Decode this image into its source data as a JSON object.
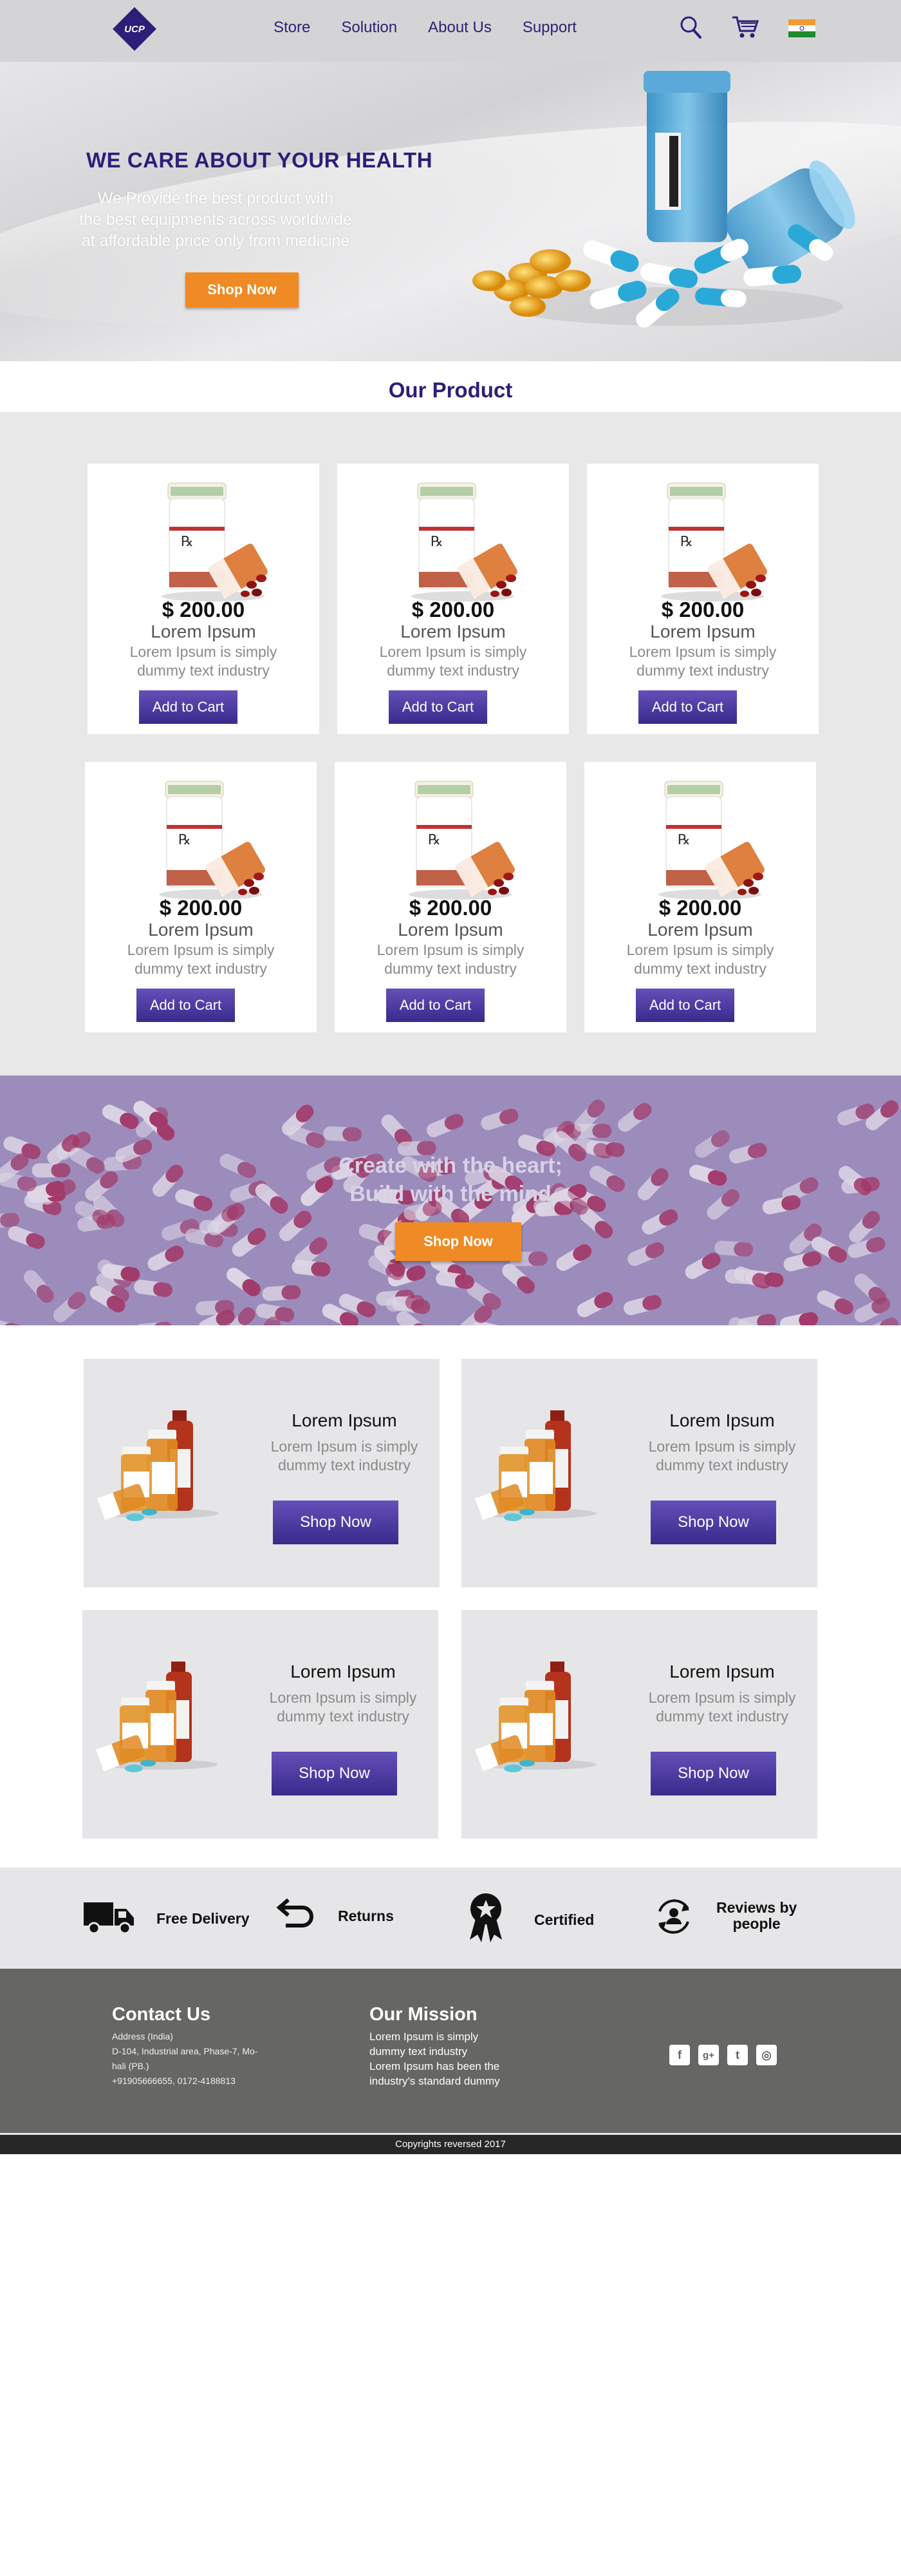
{
  "header": {
    "logo_text": "UCP",
    "nav": [
      "Store",
      "Solution",
      "About Us",
      "Support"
    ],
    "icons": [
      "search-icon",
      "cart-icon",
      "india-flag-icon"
    ]
  },
  "hero": {
    "title": "WE CARE ABOUT YOUR HEALTH",
    "subtitle_lines": [
      "We Provide the best product with",
      "the best equipments across worldwide",
      "at affordable price only from medicine"
    ],
    "button": "Shop Now"
  },
  "products_section": {
    "title": "Our Product",
    "products": [
      {
        "price": "$ 200.00",
        "name": "Lorem Ipsum",
        "desc_lines": [
          "Lorem Ipsum is simply",
          "dummy text  industry"
        ],
        "button": "Add to Cart"
      },
      {
        "price": "$ 200.00",
        "name": "Lorem Ipsum",
        "desc_lines": [
          "Lorem Ipsum is simply",
          "dummy text  industry"
        ],
        "button": "Add to Cart"
      },
      {
        "price": "$ 200.00",
        "name": "Lorem Ipsum",
        "desc_lines": [
          "Lorem Ipsum is simply",
          "dummy text  industry"
        ],
        "button": "Add to Cart"
      },
      {
        "price": "$ 200.00",
        "name": "Lorem Ipsum",
        "desc_lines": [
          "Lorem Ipsum is simply",
          "dummy text  industry"
        ],
        "button": "Add to Cart"
      },
      {
        "price": "$ 200.00",
        "name": "Lorem Ipsum",
        "desc_lines": [
          "Lorem Ipsum is simply",
          "dummy text  industry"
        ],
        "button": "Add to Cart"
      },
      {
        "price": "$ 200.00",
        "name": "Lorem Ipsum",
        "desc_lines": [
          "Lorem Ipsum is simply",
          "dummy text  industry"
        ],
        "button": "Add to Cart"
      }
    ]
  },
  "banner": {
    "lines": [
      "Create with the heart;",
      "Build with the mind"
    ],
    "button": "Shop Now"
  },
  "promos": [
    {
      "title": "Lorem Ipsum",
      "desc_lines": [
        "Lorem Ipsum is simply",
        "dummy text  industry"
      ],
      "button": "Shop Now"
    },
    {
      "title": "Lorem Ipsum",
      "desc_lines": [
        "Lorem Ipsum is simply",
        "dummy text  industry"
      ],
      "button": "Shop Now"
    },
    {
      "title": "Lorem Ipsum",
      "desc_lines": [
        "Lorem Ipsum is simply",
        "dummy text  industry"
      ],
      "button": "Shop Now"
    },
    {
      "title": "Lorem Ipsum",
      "desc_lines": [
        "Lorem Ipsum is simply",
        "dummy text  industry"
      ],
      "button": "Shop Now"
    }
  ],
  "features": [
    {
      "label": "Free Delivery",
      "icon": "truck-icon"
    },
    {
      "label": "Returns",
      "icon": "return-arrow-icon"
    },
    {
      "label": "Certified",
      "icon": "award-ribbon-icon"
    },
    {
      "label_lines": [
        "Reviews by",
        "people"
      ],
      "icon": "user-refresh-icon"
    }
  ],
  "footer": {
    "contact": {
      "title": "Contact Us",
      "lines": [
        "Address (India)",
        "D-104, Industrial area, Phase-7, Mo-",
        "hali (PB.)",
        "+91905666655, 0172-4188813"
      ]
    },
    "mission": {
      "title": "Our Mission",
      "lines": [
        "Lorem Ipsum is simply",
        "dummy text  industry",
        "Lorem Ipsum has been the",
        "industry's standard dummy"
      ]
    },
    "social_icons": [
      "facebook-icon",
      "google-plus-icon",
      "twitter-icon",
      "instagram-icon"
    ],
    "social_glyphs": [
      "f",
      "g+",
      "t",
      "◎"
    ],
    "copyright": "Copyrights reversed 2017"
  },
  "colors": {
    "brand_purple": "#2d1e78",
    "button_purple": "#4a3a9c",
    "accent_orange": "#f08a24",
    "footer_gray": "#666664"
  }
}
